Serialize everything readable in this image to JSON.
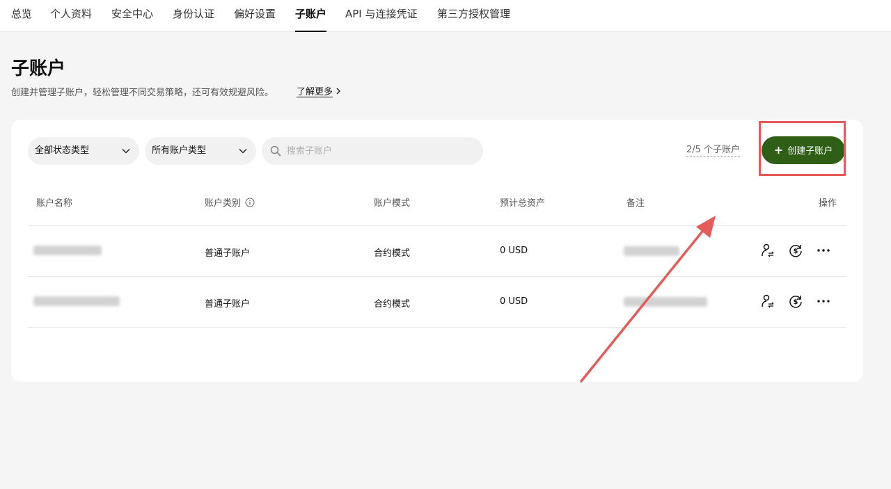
{
  "nav": {
    "tabs": [
      {
        "label": "总览"
      },
      {
        "label": "个人资料"
      },
      {
        "label": "安全中心"
      },
      {
        "label": "身份认证"
      },
      {
        "label": "偏好设置"
      },
      {
        "label": "子账户",
        "active": true
      },
      {
        "label": "API 与连接凭证"
      },
      {
        "label": "第三方授权管理"
      }
    ]
  },
  "header": {
    "title": "子账户",
    "description": "创建并管理子账户，轻松管理不同交易策略，还可有效规避风险。",
    "learn_more": "了解更多"
  },
  "filters": {
    "status_select": "全部状态类型",
    "account_type_select": "所有账户类型",
    "search_placeholder": "搜索子账户",
    "count_label": "2/5 个子账户",
    "create_button": "创建子账户"
  },
  "table": {
    "columns": [
      "账户名称",
      "账户类别",
      "账户模式",
      "预计总资产",
      "备注",
      "操作"
    ],
    "rows": [
      {
        "name": "",
        "category": "普通子账户",
        "mode": "合约模式",
        "assets": "0 USD",
        "note": ""
      },
      {
        "name": "",
        "category": "普通子账户",
        "mode": "合约模式",
        "assets": "0 USD",
        "note": ""
      }
    ]
  },
  "colors": {
    "accent_button": "#2f5f17",
    "annotation_red": "#e65a5a",
    "page_bg": "#f5f5f5"
  },
  "icons": [
    "chevron-down-icon",
    "search-icon",
    "info-icon",
    "plus-icon",
    "user-transfer-icon",
    "dollar-cycle-icon",
    "more-icon",
    "chevron-right-icon"
  ]
}
